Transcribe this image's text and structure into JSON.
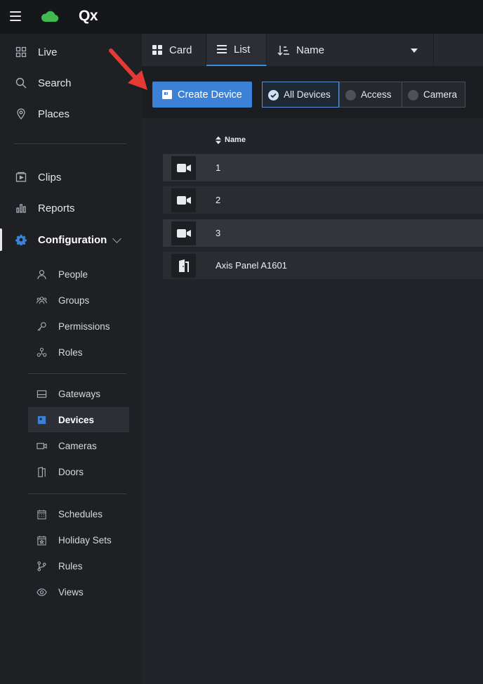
{
  "app": {
    "brand": "Qx",
    "brand_colors": {
      "cloud": "#3fb950",
      "accent": "#3b82d6"
    }
  },
  "sidebar": {
    "primary": [
      {
        "label": "Live",
        "icon": "live-grid-icon"
      },
      {
        "label": "Search",
        "icon": "search-icon"
      },
      {
        "label": "Places",
        "icon": "location-pin-icon"
      }
    ],
    "secondary": [
      {
        "label": "Clips",
        "icon": "clips-icon"
      },
      {
        "label": "Reports",
        "icon": "bar-chart-icon"
      },
      {
        "label": "Configuration",
        "icon": "gear-icon",
        "active": true,
        "expanded": true
      }
    ],
    "config_groups": [
      [
        {
          "label": "People",
          "icon": "person-icon"
        },
        {
          "label": "Groups",
          "icon": "group-icon"
        },
        {
          "label": "Permissions",
          "icon": "key-icon"
        },
        {
          "label": "Roles",
          "icon": "roles-icon"
        }
      ],
      [
        {
          "label": "Gateways",
          "icon": "gateway-icon"
        },
        {
          "label": "Devices",
          "icon": "device-icon",
          "active": true
        },
        {
          "label": "Cameras",
          "icon": "camera-icon"
        },
        {
          "label": "Doors",
          "icon": "door-icon"
        }
      ],
      [
        {
          "label": "Schedules",
          "icon": "calendar-icon"
        },
        {
          "label": "Holiday Sets",
          "icon": "holiday-calendar-icon"
        },
        {
          "label": "Rules",
          "icon": "branch-icon"
        },
        {
          "label": "Views",
          "icon": "eye-icon"
        }
      ]
    ]
  },
  "toolbar": {
    "card_label": "Card",
    "list_label": "List",
    "sort_label": "Name",
    "selected_view": "List"
  },
  "actions": {
    "create_label": "Create Device",
    "filters": [
      {
        "label": "All Devices",
        "selected": true
      },
      {
        "label": "Access",
        "selected": false
      },
      {
        "label": "Camera",
        "selected": false
      }
    ]
  },
  "table": {
    "column_name": "Name",
    "rows": [
      {
        "name": "1",
        "type": "camera-icon"
      },
      {
        "name": "2",
        "type": "camera-icon"
      },
      {
        "name": "3",
        "type": "camera-icon"
      },
      {
        "name": "Axis Panel A1601",
        "type": "door-icon"
      }
    ]
  }
}
